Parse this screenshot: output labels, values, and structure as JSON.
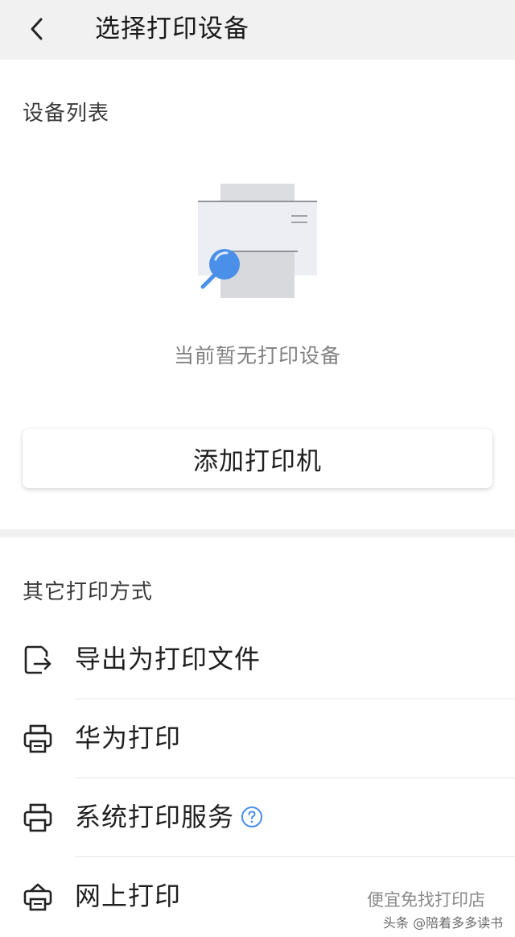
{
  "header": {
    "title": "选择打印设备",
    "back_icon": "chevron-left-icon"
  },
  "device_list": {
    "title": "设备列表",
    "empty_text": "当前暂无打印设备",
    "empty_icon": "printer-search-icon",
    "add_button_label": "添加打印机"
  },
  "other_methods": {
    "title": "其它打印方式",
    "items": [
      {
        "label": "导出为打印文件",
        "icon": "export-file-icon"
      },
      {
        "label": "华为打印",
        "icon": "printer-icon"
      },
      {
        "label": "系统打印服务",
        "icon": "printer-icon",
        "help_icon": "question-circle-icon"
      },
      {
        "label": "网上打印",
        "icon": "online-printer-icon"
      }
    ]
  },
  "watermark": {
    "line1": "便宜免找打印店",
    "line2": "头条 @陪着多多读书"
  },
  "colors": {
    "accent": "#4a8fe8",
    "header_bg": "#f1f1f1",
    "divider": "#e6e6e6"
  }
}
